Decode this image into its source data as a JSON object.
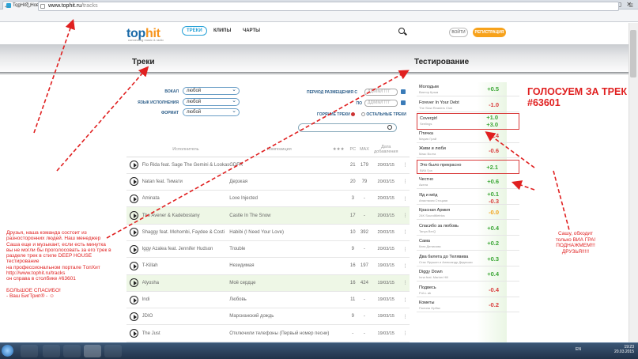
{
  "browser": {
    "tab_title": "TopHit - Новая Музыка",
    "url_host": "www.tophit.ru",
    "url_path": "/tracks"
  },
  "site": {
    "logo_main": "top",
    "logo_accent": "hit",
    "logo_tagline": "connecting music & radio",
    "nav": [
      "ТРЕКИ",
      "КЛИПЫ",
      "ЧАРТЫ"
    ],
    "login": "ВОЙТИ",
    "register": "РЕГИСТРАЦИЯ"
  },
  "tracks_section": {
    "title": "Треки",
    "filters": {
      "vocal_label": "ВОКАЛ",
      "vocal_value": "любой",
      "lang_label": "ЯЗЫК ИСПОЛНЕНИЯ",
      "lang_value": "любой",
      "format_label": "ФОРМАТ",
      "format_value": "любой",
      "period_label": "ПЕРИОД РАЗМЕЩЕНИЯ С",
      "period_to_label": "ПО",
      "date_placeholder": "ДД/ММ/ГГГГ",
      "hot_label": "ГОРЯЧИЕ ТРЕКИ",
      "other_label": "ОСТАЛЬНЫЕ ТРЕКИ"
    },
    "columns": [
      "Исполнитель",
      "Композиция",
      "★★★",
      "PC",
      "MAX",
      "Дата добавления"
    ],
    "rows": [
      {
        "artist": "Flo Rida feat. Sage The Gemini & Lookas",
        "song": "GDFR",
        "pc": "21",
        "max": "179",
        "date": "20/03/15",
        "hl": false
      },
      {
        "artist": "Natan feat. Тимати",
        "song": "Дерзкая",
        "pc": "20",
        "max": "79",
        "date": "20/03/15",
        "hl": false
      },
      {
        "artist": "Aminata",
        "song": "Love Injected",
        "pc": "3",
        "max": "-",
        "date": "20/03/15",
        "hl": false
      },
      {
        "artist": "The Avener & Kadebostany",
        "song": "Castle In The Snow",
        "pc": "17",
        "max": "-",
        "date": "20/03/15",
        "hl": true
      },
      {
        "artist": "Shaggy feat. Mohombi, Faydee & Costi",
        "song": "Habibi (I Need Your Love)",
        "pc": "10",
        "max": "392",
        "date": "20/03/15",
        "hl": false
      },
      {
        "artist": "Iggy Azalea feat. Jennifer Hudson",
        "song": "Trouble",
        "pc": "9",
        "max": "-",
        "date": "20/03/15",
        "hl": false
      },
      {
        "artist": "T-Killah",
        "song": "Незидимая",
        "pc": "16",
        "max": "197",
        "date": "19/03/15",
        "hl": false
      },
      {
        "artist": "Alyosha",
        "song": "Моё сердце",
        "pc": "16",
        "max": "424",
        "date": "19/03/15",
        "hl": true
      },
      {
        "artist": "Indi",
        "song": "Любовь",
        "pc": "11",
        "max": "-",
        "date": "19/03/15",
        "hl": false
      },
      {
        "artist": "JDIO",
        "song": "Марсианский дождь",
        "pc": "9",
        "max": "-",
        "date": "19/03/15",
        "hl": false
      },
      {
        "artist": "The Just",
        "song": "Отключили телефоны (Первый номер песни)",
        "pc": "-",
        "max": "-",
        "date": "19/03/15",
        "hl": false
      }
    ]
  },
  "testing_section": {
    "title": "Тестирование",
    "rows": [
      {
        "title": "Молодым",
        "artist": "Виктор Крым",
        "scores": [
          "+0.5"
        ],
        "types": [
          "pos"
        ],
        "box": false
      },
      {
        "title": "Forever In Your Debt",
        "artist": "The Slow Readers Club",
        "scores": [
          "-1.0"
        ],
        "types": [
          "neg"
        ],
        "box": false
      },
      {
        "title": "Covergirl",
        "artist": "Seelings",
        "scores": [
          "+1.0",
          "+3.0"
        ],
        "types": [
          "pos",
          "pos"
        ],
        "box": true
      },
      {
        "title": "Птичка",
        "artist": "Мария Грай",
        "scores": [
          "-0.4"
        ],
        "types": [
          "neg"
        ],
        "box": false
      },
      {
        "title": "Живи и люби",
        "artist": "Макс Волга",
        "scores": [
          "-0.6"
        ],
        "types": [
          "neg"
        ],
        "box": false
      },
      {
        "title": "Это было прекрасно",
        "artist": "ВИА Гра",
        "scores": [
          "+2.1"
        ],
        "types": [
          "pos"
        ],
        "box": true
      },
      {
        "title": "Честно",
        "artist": "Акела",
        "scores": [
          "+0.6"
        ],
        "types": [
          "pos"
        ],
        "box": false
      },
      {
        "title": "Яд и мёд",
        "artist": "Анастасия Стоцкая",
        "scores": [
          "+0.1",
          "-0.3"
        ],
        "types": [
          "pos",
          "neg"
        ],
        "box": false
      },
      {
        "title": "Красная Армия",
        "artist": "24K SoundMetrics",
        "scores": [
          "-0.0"
        ],
        "types": [
          "neu"
        ],
        "box": false
      },
      {
        "title": "Спасибо за любовь",
        "artist": "Tanya BerQ",
        "scores": [
          "+0.4"
        ],
        "types": [
          "pos"
        ],
        "box": false
      },
      {
        "title": "Сама",
        "artist": "Катя Денисова",
        "scores": [
          "+0.2"
        ],
        "types": [
          "pos"
        ],
        "box": false
      },
      {
        "title": "Два билета до Телявива",
        "artist": "Стас Ярушин и Александр Дедюшко",
        "scores": [
          "+0.3"
        ],
        "types": [
          "pos"
        ],
        "box": false
      },
      {
        "title": "Diggy Down",
        "artist": "Inna feat. Marian Hill",
        "scores": [
          "+0.4"
        ],
        "types": [
          "pos"
        ],
        "box": false
      },
      {
        "title": "Подвесь",
        "artist": "FULL ab",
        "scores": [
          "-0.4"
        ],
        "types": [
          "neg"
        ],
        "box": false
      },
      {
        "title": "Кометы",
        "artist": "Полина Орбах",
        "scores": [
          "-0.2"
        ],
        "types": [
          "neg"
        ],
        "box": false
      }
    ]
  },
  "annotations": {
    "vote_title_line1": "ГОЛОСУЕМ ЗА ТРЕК",
    "vote_title_line2": "#63601",
    "sasha_note": [
      "Сашу, обходит",
      "только ВИА ГРА!",
      "ПОДНАЖМЕМ!!!",
      "ДРУЗЬЯ!!!!!"
    ],
    "left_note": [
      "Друзья, наша команда состоит из",
      "разносторонних людей. Наш менеджер",
      "Саша еще и музыкант, если есть минутка",
      " вы не могли бы проголосовать за его трек в",
      "разделе трек в стиле DEEP HOUSE",
      "тестирование",
      "на профессиональном портале TопХит",
      " http://www.tophit.ru/tracks",
      "он справа в столбике #63601",
      "",
      "БОЛЬШОЕ СПАСИБО!",
      "- Ваш БигТрип® - ☺"
    ],
    "arrow_color": "#e02020"
  },
  "taskbar": {
    "lang": "EN",
    "time": "19:23",
    "date": "20.03.2015"
  }
}
